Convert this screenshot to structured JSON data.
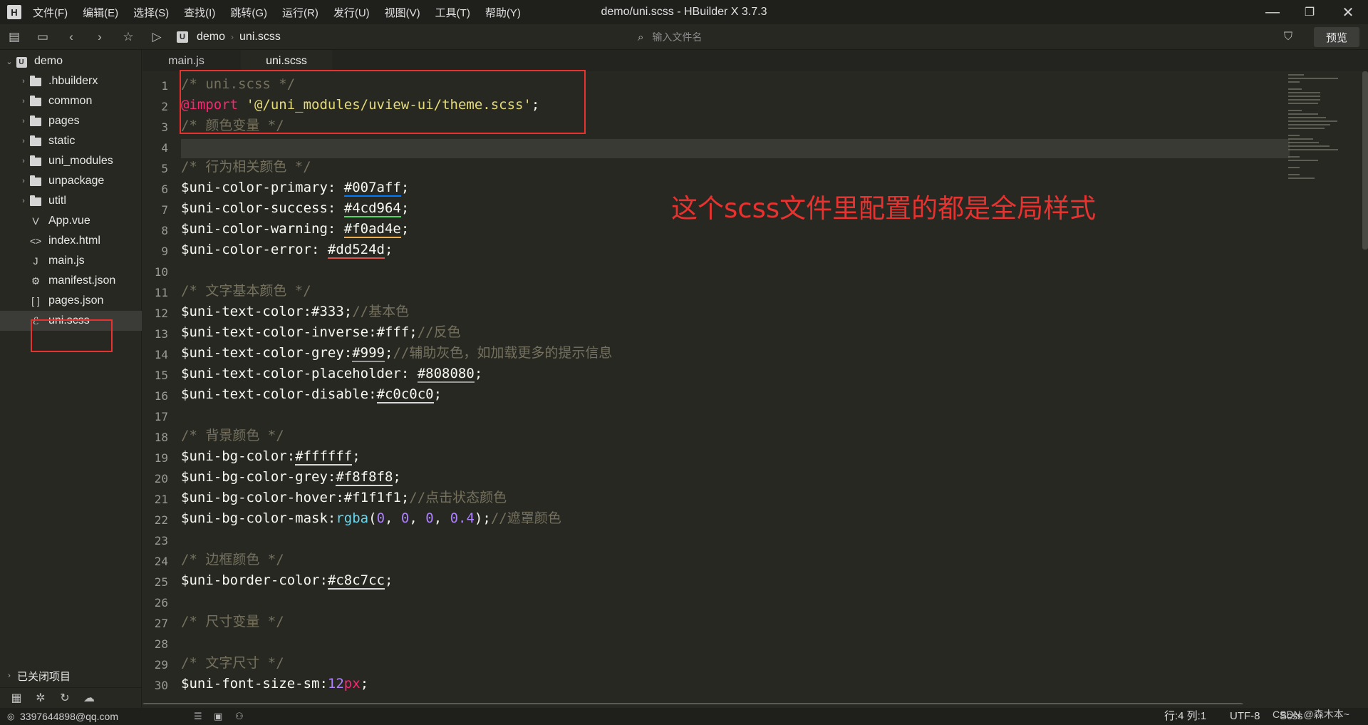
{
  "window": {
    "title": "demo/uni.scss - HBuilder X 3.7.3",
    "logo": "H",
    "minimize": "—",
    "maximize": "❐",
    "close": "✕"
  },
  "menu": [
    "文件(F)",
    "编辑(E)",
    "选择(S)",
    "查找(I)",
    "跳转(G)",
    "运行(R)",
    "发行(U)",
    "视图(V)",
    "工具(T)",
    "帮助(Y)"
  ],
  "toolbar": {
    "icons": [
      "new-file-icon",
      "save-icon",
      "back-icon",
      "forward-icon",
      "star-icon",
      "run-icon"
    ],
    "breadcrumb": [
      "demo",
      "uni.scss"
    ],
    "search_placeholder": "输入文件名",
    "preview_label": "预览"
  },
  "sidebar": {
    "root": "demo",
    "items": [
      {
        "label": ".hbuilderx",
        "type": "folder"
      },
      {
        "label": "common",
        "type": "folder"
      },
      {
        "label": "pages",
        "type": "folder"
      },
      {
        "label": "static",
        "type": "folder"
      },
      {
        "label": "uni_modules",
        "type": "folder"
      },
      {
        "label": "unpackage",
        "type": "folder"
      },
      {
        "label": "utitl",
        "type": "folder"
      },
      {
        "label": "App.vue",
        "type": "file",
        "icon": "V"
      },
      {
        "label": "index.html",
        "type": "file",
        "icon": "<>"
      },
      {
        "label": "main.js",
        "type": "file",
        "icon": "J"
      },
      {
        "label": "manifest.json",
        "type": "file",
        "icon": "⚙"
      },
      {
        "label": "pages.json",
        "type": "file",
        "icon": "[ ]"
      },
      {
        "label": "uni.scss",
        "type": "file",
        "icon": "ℰ",
        "selected": true
      }
    ],
    "closed_projects": "已关闭项目"
  },
  "tabs": [
    {
      "label": "main.js",
      "active": false
    },
    {
      "label": "uni.scss",
      "active": true
    }
  ],
  "editor": {
    "line_numbers": [
      "1",
      "2",
      "3",
      "4",
      "5",
      "6",
      "7",
      "8",
      "9",
      "10",
      "11",
      "12",
      "13",
      "14",
      "15",
      "16",
      "17",
      "18",
      "19",
      "20",
      "21",
      "22",
      "23",
      "24",
      "25",
      "26",
      "27",
      "28",
      "29",
      "30"
    ],
    "lines": [
      [
        {
          "t": "/* uni.scss */",
          "c": "cm"
        }
      ],
      [
        {
          "t": "@import",
          "c": "at"
        },
        {
          "t": " "
        },
        {
          "t": "'@/uni_modules/uview-ui/theme.scss'",
          "c": "str"
        },
        {
          "t": ";"
        }
      ],
      [
        {
          "t": "/* 颜色变量 */",
          "c": "cm"
        }
      ],
      [],
      [
        {
          "t": "/* 行为相关颜色 */",
          "c": "cm"
        }
      ],
      [
        {
          "t": "$uni-color-primary: "
        },
        {
          "t": "#007aff",
          "c": "u-blue"
        },
        {
          "t": ";"
        }
      ],
      [
        {
          "t": "$uni-color-success: "
        },
        {
          "t": "#4cd964",
          "c": "u-green"
        },
        {
          "t": ";"
        }
      ],
      [
        {
          "t": "$uni-color-warning: "
        },
        {
          "t": "#f0ad4e",
          "c": "u-orange"
        },
        {
          "t": ";"
        }
      ],
      [
        {
          "t": "$uni-color-error: "
        },
        {
          "t": "#dd524d",
          "c": "u-red"
        },
        {
          "t": ";"
        }
      ],
      [],
      [
        {
          "t": "/* 文字基本颜色 */",
          "c": "cm"
        }
      ],
      [
        {
          "t": "$uni-text-color:#333;"
        },
        {
          "t": "//基本色",
          "c": "cm"
        }
      ],
      [
        {
          "t": "$uni-text-color-inverse:#fff;"
        },
        {
          "t": "//反色",
          "c": "cm"
        }
      ],
      [
        {
          "t": "$uni-text-color-grey:"
        },
        {
          "t": "#999",
          "c": "u-grey"
        },
        {
          "t": ";"
        },
        {
          "t": "//辅助灰色，如加载更多的提示信息",
          "c": "cm"
        }
      ],
      [
        {
          "t": "$uni-text-color-placeholder: "
        },
        {
          "t": "#808080",
          "c": "u-grey"
        },
        {
          "t": ";"
        }
      ],
      [
        {
          "t": "$uni-text-color-disable:"
        },
        {
          "t": "#c0c0c0",
          "c": "u-light"
        },
        {
          "t": ";"
        }
      ],
      [],
      [
        {
          "t": "/* 背景颜色 */",
          "c": "cm"
        }
      ],
      [
        {
          "t": "$uni-bg-color:"
        },
        {
          "t": "#ffffff",
          "c": "u-light"
        },
        {
          "t": ";"
        }
      ],
      [
        {
          "t": "$uni-bg-color-grey:"
        },
        {
          "t": "#f8f8f8",
          "c": "u-light"
        },
        {
          "t": ";"
        }
      ],
      [
        {
          "t": "$uni-bg-color-hover:#f1f1f1;"
        },
        {
          "t": "//点击状态颜色",
          "c": "cm"
        }
      ],
      [
        {
          "t": "$uni-bg-color-mask:"
        },
        {
          "t": "rgba",
          "c": "fn"
        },
        {
          "t": "("
        },
        {
          "t": "0",
          "c": "num"
        },
        {
          "t": ", "
        },
        {
          "t": "0",
          "c": "num"
        },
        {
          "t": ", "
        },
        {
          "t": "0",
          "c": "num"
        },
        {
          "t": ", "
        },
        {
          "t": "0.4",
          "c": "num"
        },
        {
          "t": ");"
        },
        {
          "t": "//遮罩颜色",
          "c": "cm"
        }
      ],
      [],
      [
        {
          "t": "/* 边框颜色 */",
          "c": "cm"
        }
      ],
      [
        {
          "t": "$uni-border-color:"
        },
        {
          "t": "#c8c7cc",
          "c": "u-light"
        },
        {
          "t": ";"
        }
      ],
      [],
      [
        {
          "t": "/* 尺寸变量 */",
          "c": "cm"
        }
      ],
      [],
      [
        {
          "t": "/* 文字尺寸 */",
          "c": "cm"
        }
      ],
      [
        {
          "t": "$uni-font-size-sm:"
        },
        {
          "t": "12",
          "c": "num"
        },
        {
          "t": "px",
          "c": "at"
        },
        {
          "t": ";"
        }
      ]
    ]
  },
  "annotation": "这个scss文件里配置的都是全局样式",
  "statusbar": {
    "user": "3397644898@qq.com",
    "position": "行:4  列:1",
    "encoding": "UTF-8",
    "language": "Scss",
    "watermark": "CSDN @森木本~"
  },
  "colors": {
    "background": "#272822",
    "annotation": "#e8322f",
    "comment": "#75715e",
    "keyword": "#f92672",
    "string": "#e6db74",
    "number": "#ae81ff"
  }
}
